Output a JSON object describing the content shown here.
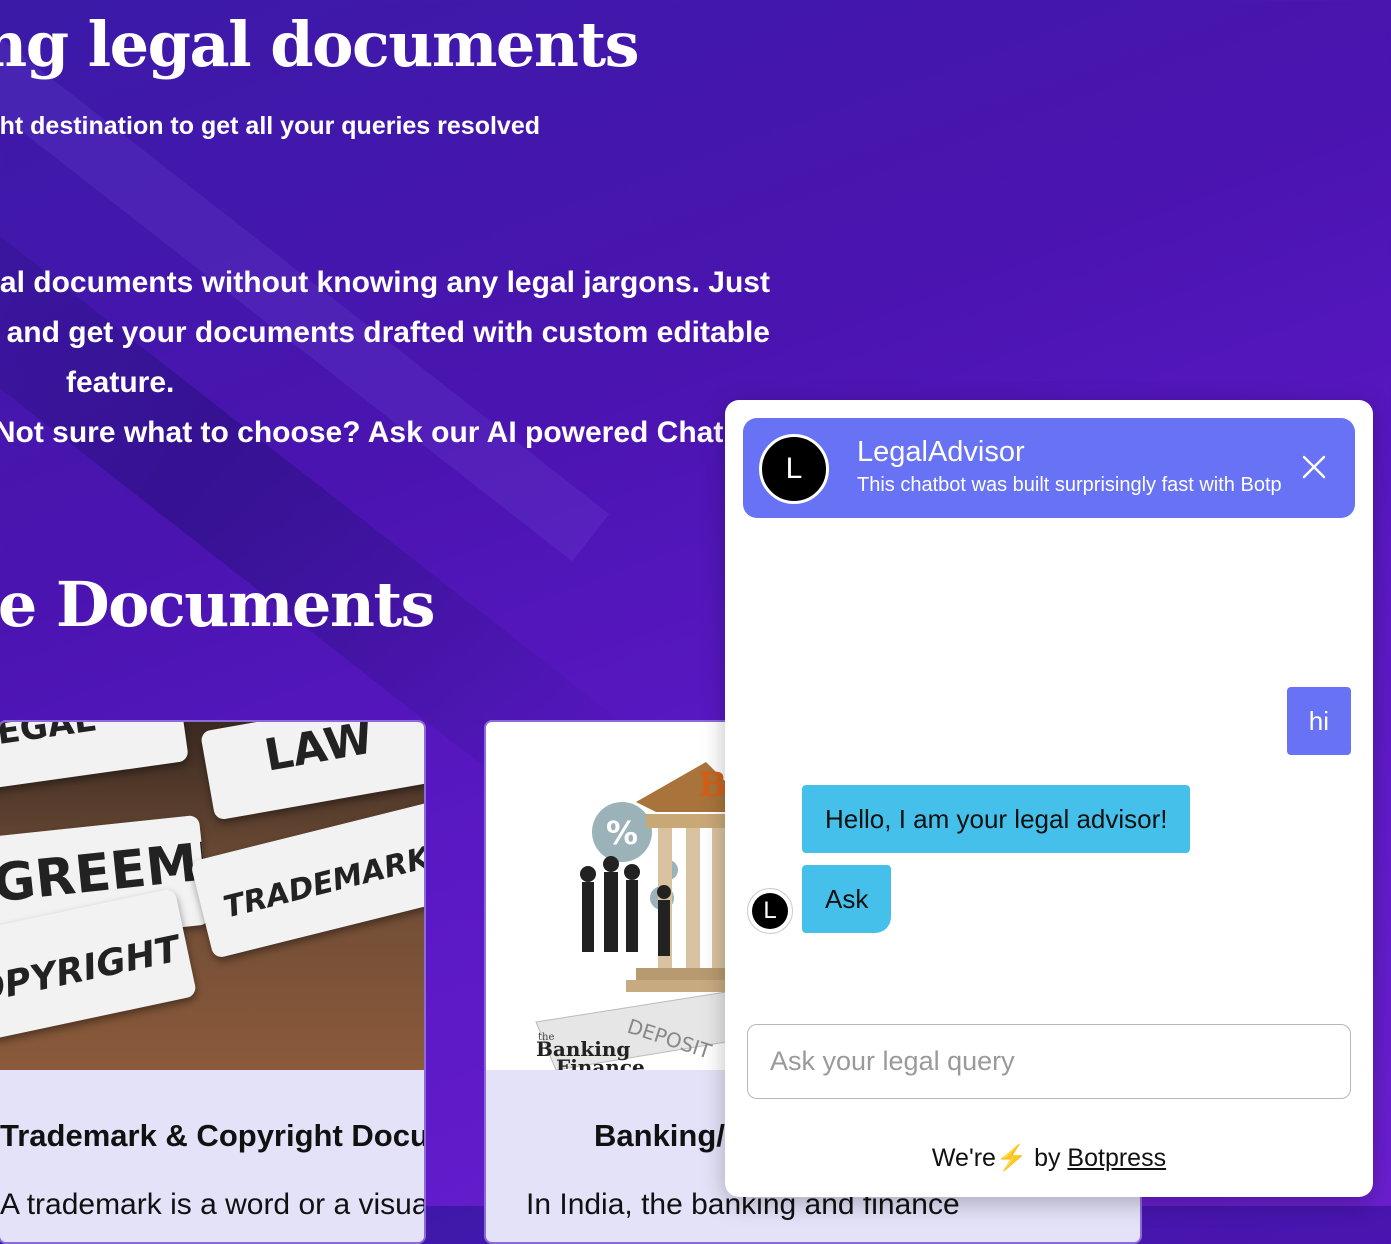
{
  "hero": {
    "title": "Need help making legal documents?",
    "subtitle": "You're at the right destination to get all your queries resolved!",
    "body_lines": [
      "Draft your legal documents without knowing any legal jargons. Just",
      "choose the template and get your documents drafted with custom editable",
      "feature.",
      "Not sure what to choose? Ask our AI powered Chatbot!!"
    ]
  },
  "documents": {
    "title": "Available Documents",
    "cards": [
      {
        "title": "Trademark & Copyright Documents",
        "text": "A trademark is a word or a visual",
        "image_labels": [
          "LAW",
          "TRADEMARK",
          "COPYRIGHT",
          "AGREEMENT",
          "LEGAL"
        ]
      },
      {
        "title": "Banking/Finance Documents",
        "text": "In India, the banking and finance",
        "image_labels": [
          "B",
          "DEPOSIT",
          "Banking",
          "Finance",
          "the",
          "%"
        ]
      }
    ]
  },
  "chat": {
    "bot_name": "LegalAdvisor",
    "bot_description": "This chatbot was built surprisingly fast with Botpress",
    "avatar_letter": "L",
    "messages": [
      {
        "from": "user",
        "text": "hi"
      },
      {
        "from": "bot",
        "text": "Hello, I am your legal advisor!"
      },
      {
        "from": "bot",
        "text": "Ask"
      }
    ],
    "input_placeholder": "Ask your legal query",
    "footer_prefix": "We're",
    "footer_bolt": "⚡",
    "footer_by": "by",
    "footer_link": "Botpress",
    "close_icon": "close-icon"
  },
  "colors": {
    "header": "#6772f5",
    "bot_bubble": "#45c0ea",
    "user_bubble": "#6772f5",
    "background": "#4a14b0"
  }
}
